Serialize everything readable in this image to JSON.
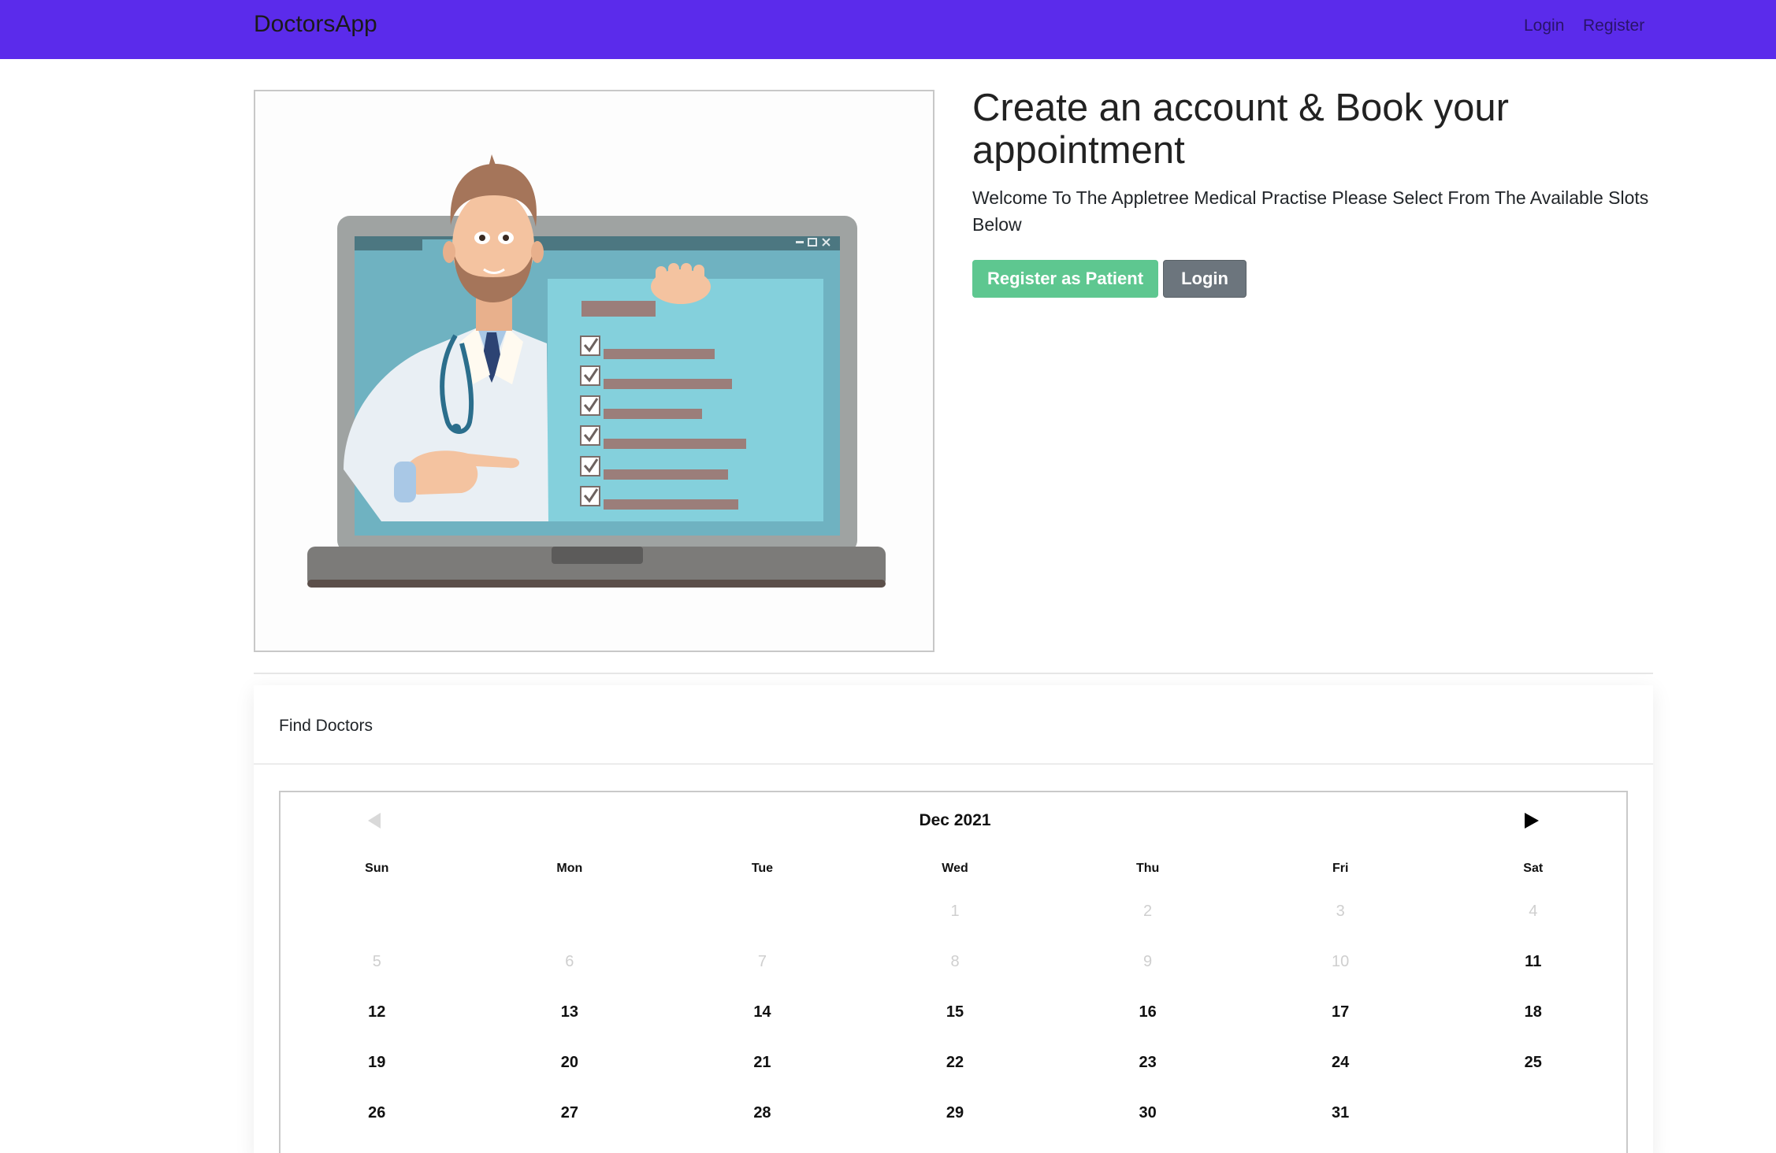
{
  "navbar": {
    "brand": "DoctorsApp",
    "links": [
      "Login",
      "Register"
    ],
    "color": "#5b2beb"
  },
  "hero": {
    "title": "Create an account & Book your appointment",
    "subtitle": "Welcome To The Appletree Medical Practise Please Select From The Available Slots Below",
    "buttons": {
      "register": "Register as Patient",
      "login": "Login"
    },
    "image": "doctor-with-laptop-checklist-illustration",
    "colors": {
      "register": "#5ec790",
      "login": "#6c757d"
    }
  },
  "find_doctors": {
    "title": "Find Doctors"
  },
  "calendar": {
    "month": "Dec 2021",
    "prev_icon": "triangle-left-icon",
    "next_icon": "triangle-right-icon",
    "weekdays": [
      "Sun",
      "Mon",
      "Tue",
      "Wed",
      "Thu",
      "Fri",
      "Sat"
    ],
    "weeks": [
      [
        "",
        "",
        "",
        "1",
        "2",
        "3",
        "4"
      ],
      [
        "5",
        "6",
        "7",
        "8",
        "9",
        "10",
        "11"
      ],
      [
        "12",
        "13",
        "14",
        "15",
        "16",
        "17",
        "18"
      ],
      [
        "19",
        "20",
        "21",
        "22",
        "23",
        "24",
        "25"
      ],
      [
        "26",
        "27",
        "28",
        "29",
        "30",
        "31",
        ""
      ]
    ],
    "disabled_days": [
      "1",
      "2",
      "3",
      "4",
      "5",
      "6",
      "7",
      "8",
      "9",
      "10"
    ]
  }
}
